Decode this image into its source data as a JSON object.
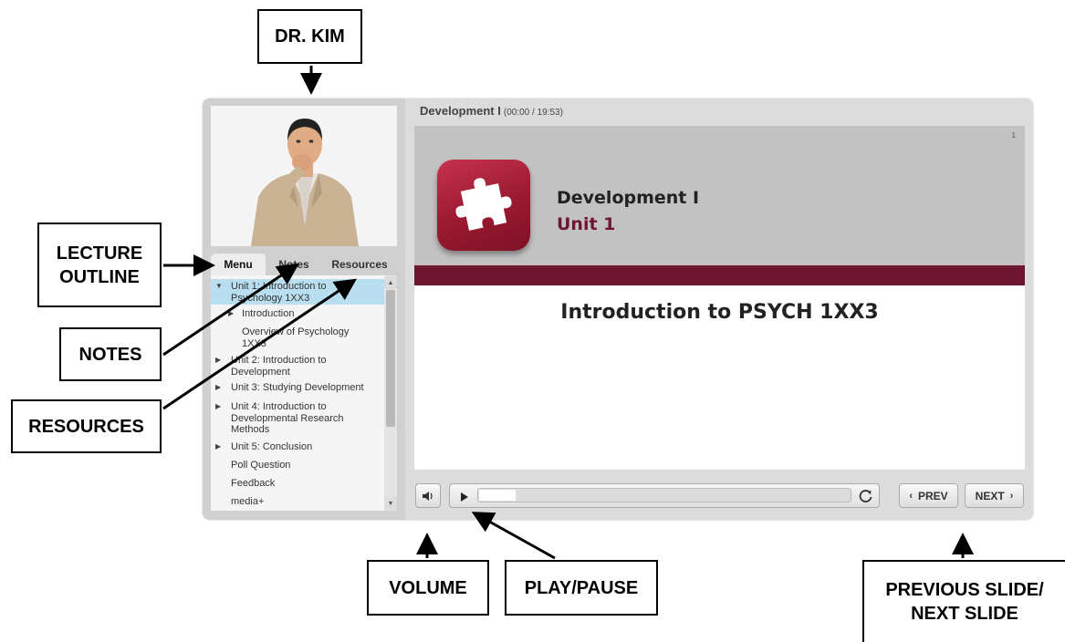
{
  "annotations": {
    "presenter": "DR. KIM",
    "outline_line1": "LECTURE",
    "outline_line2": "OUTLINE",
    "notes": "NOTES",
    "resources": "RESOURCES",
    "volume": "VOLUME",
    "play_pause": "PLAY/PAUSE",
    "prev_next_line1": "PREVIOUS SLIDE/",
    "prev_next_line2": "NEXT SLIDE"
  },
  "player": {
    "title": "Development I",
    "time": "(00:00 / 19:53)",
    "progress": 0.0,
    "tabs": [
      "Menu",
      "Notes",
      "Resources"
    ],
    "active_tab": "Menu",
    "outline": [
      {
        "label_line1": "Unit 1: Introduction to",
        "label_line2": "Psychology 1XX3",
        "level": 0,
        "expanded": true,
        "active": true
      },
      {
        "label_line1": "Introduction",
        "level": 1,
        "collapsed": true
      },
      {
        "label_line1": "Overview of Psychology",
        "label_line2": "1XX3",
        "level": 1
      },
      {
        "label_line1": "Unit 2: Introduction to",
        "label_line2": "Development",
        "level": 0,
        "collapsed": true
      },
      {
        "label_line1": "Unit 3: Studying Development",
        "level": 0,
        "collapsed": true
      },
      {
        "label_line1": "Unit 4: Introduction to",
        "label_line2": "Developmental Research",
        "label_line3": "Methods",
        "level": 0,
        "collapsed": true
      },
      {
        "label_line1": "Unit 5: Conclusion",
        "level": 0,
        "collapsed": true
      },
      {
        "label_line1": "Poll Question",
        "level": 0
      },
      {
        "label_line1": "Feedback",
        "level": 0
      },
      {
        "label_line1": "media+",
        "level": 0
      }
    ],
    "prev_label": "PREV",
    "next_label": "NEXT"
  },
  "slide": {
    "number": "1",
    "title": "Development I",
    "subtitle": "Unit 1",
    "heading": "Introduction to PSYCH 1XX3",
    "icon": "puzzle-piece-icon"
  },
  "colors": {
    "accent": "#6e1630",
    "active_item": "#b9def0"
  }
}
